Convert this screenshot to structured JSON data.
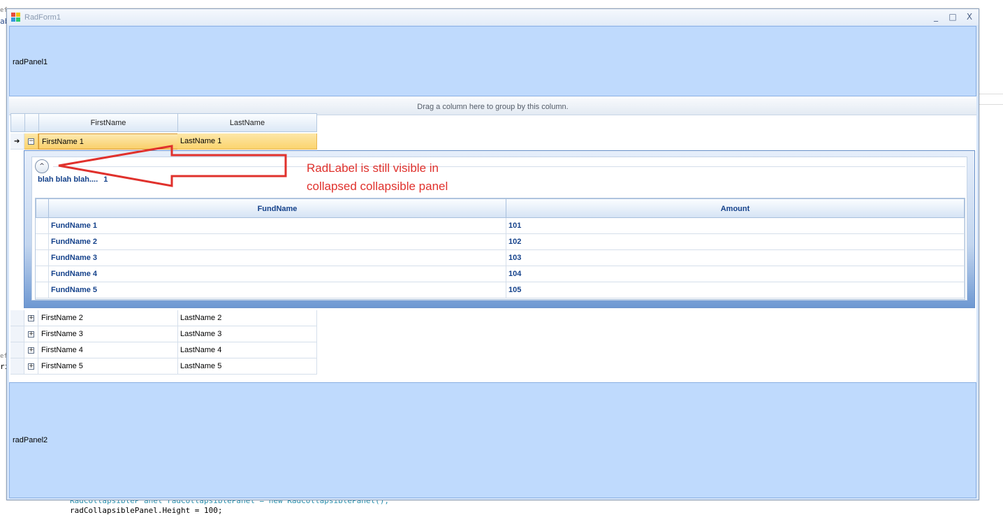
{
  "background": {
    "code_line_1": "RadCollapsibleP anel radCollapsiblePanel = new RadCollapsiblePanel();",
    "code_line_2": "radCollapsiblePanel.Height = 100;",
    "frag_a": "ef",
    "frag_b": "ab",
    "frag_c": "ef",
    "frag_d": "ri"
  },
  "window": {
    "title": "RadForm1",
    "minimize_glyph": "_",
    "maximize_glyph": "□",
    "close_glyph": "X"
  },
  "top_panel": {
    "label": "radPanel1"
  },
  "bottom_panel": {
    "label": "radPanel2"
  },
  "grid": {
    "group_hint": "Drag a column here to group by this column.",
    "columns": [
      "FirstName",
      "LastName"
    ],
    "rows": [
      {
        "first": "FirstName 1",
        "last": "LastName 1"
      },
      {
        "first": "FirstName 2",
        "last": "LastName 2"
      },
      {
        "first": "FirstName 3",
        "last": "LastName 3"
      },
      {
        "first": "FirstName 4",
        "last": "LastName 4"
      },
      {
        "first": "FirstName 5",
        "last": "LastName 5"
      }
    ],
    "current_row_glyph": "➔",
    "expanded_glyph": "−",
    "collapsed_glyph": "+"
  },
  "child": {
    "collapse_glyph": "^",
    "label_text": "blah blah blah....",
    "label_value": "1",
    "columns": [
      "FundName",
      "Amount"
    ],
    "rows": [
      {
        "fund": "FundName 1",
        "amount": "101"
      },
      {
        "fund": "FundName 2",
        "amount": "102"
      },
      {
        "fund": "FundName 3",
        "amount": "103"
      },
      {
        "fund": "FundName 4",
        "amount": "104"
      },
      {
        "fund": "FundName 5",
        "amount": "105"
      }
    ]
  },
  "annotation": {
    "text": "RadLabel is still visible in collapsed collapsible panel",
    "color": "#e0312c"
  }
}
